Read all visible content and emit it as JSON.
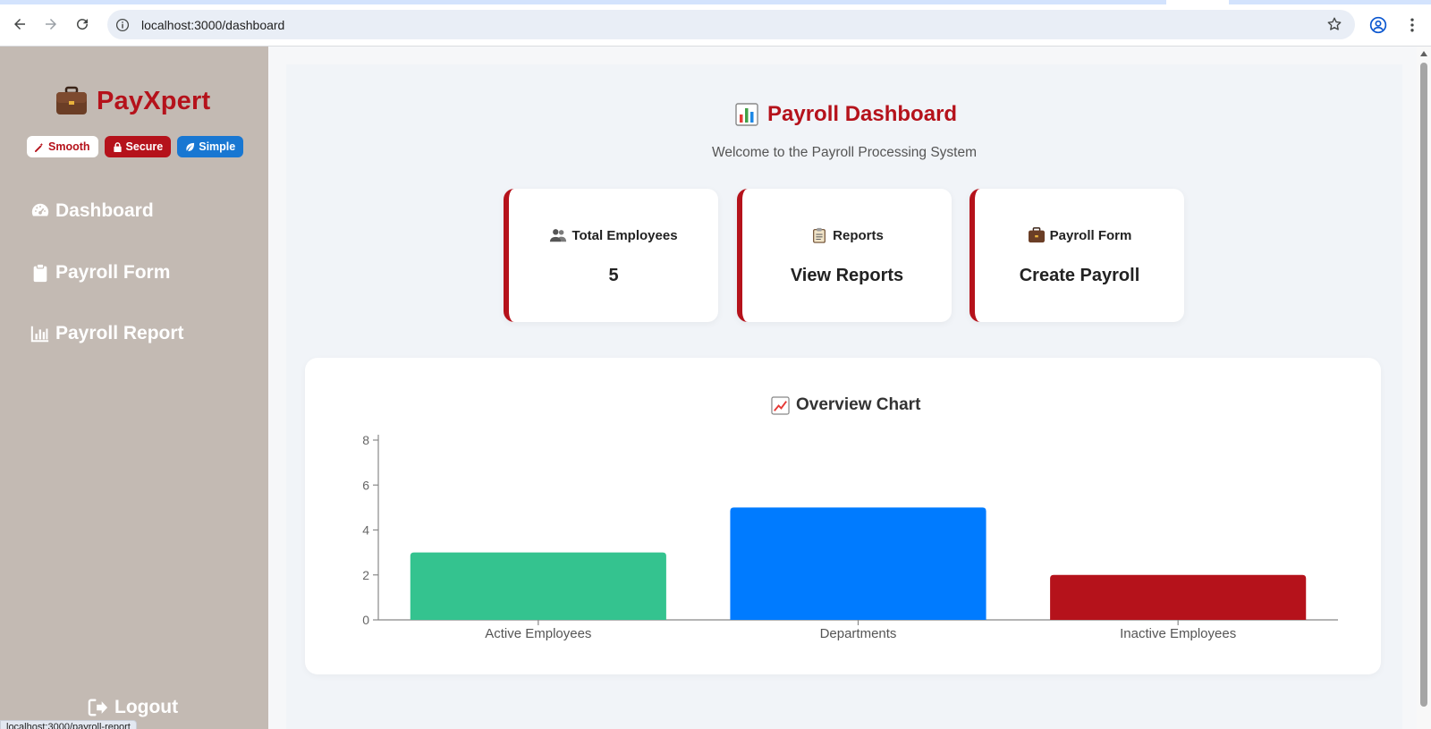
{
  "browser": {
    "url": "localhost:3000/dashboard",
    "status_url": "localhost:3000/payroll-report"
  },
  "sidebar": {
    "brand": "PayXpert",
    "badges": [
      {
        "label": "Smooth",
        "icon": "magic-wand-icon"
      },
      {
        "label": "Secure",
        "icon": "lock-icon"
      },
      {
        "label": "Simple",
        "icon": "leaf-icon"
      }
    ],
    "items": [
      {
        "label": "Dashboard",
        "icon": "gauge-icon"
      },
      {
        "label": "Payroll Form",
        "icon": "clipboard-icon"
      },
      {
        "label": "Payroll Report",
        "icon": "bar-chart-icon"
      }
    ],
    "logout": "Logout"
  },
  "main": {
    "title": "Payroll Dashboard",
    "subtitle": "Welcome to the Payroll Processing System",
    "cards": [
      {
        "title": "Total Employees",
        "value": "5",
        "icon": "people-icon"
      },
      {
        "title": "Reports",
        "value": "View Reports",
        "icon": "clipboard-icon"
      },
      {
        "title": "Payroll Form",
        "value": "Create Payroll",
        "icon": "briefcase-icon"
      }
    ],
    "chart_title": "Overview Chart"
  },
  "colors": {
    "brand_red": "#b5121b",
    "sidebar_bg": "#c3bab3",
    "accent_blue": "#1877d2"
  },
  "chart_data": {
    "type": "bar",
    "title": "Overview Chart",
    "categories": [
      "Active Employees",
      "Departments",
      "Inactive Employees"
    ],
    "values": [
      3,
      5,
      2
    ],
    "colors": [
      "#34c38f",
      "#007bff",
      "#b5121b"
    ],
    "ylim": [
      0,
      8
    ],
    "yticks": [
      0,
      2,
      4,
      6,
      8
    ],
    "grid": false,
    "legend": "none"
  }
}
